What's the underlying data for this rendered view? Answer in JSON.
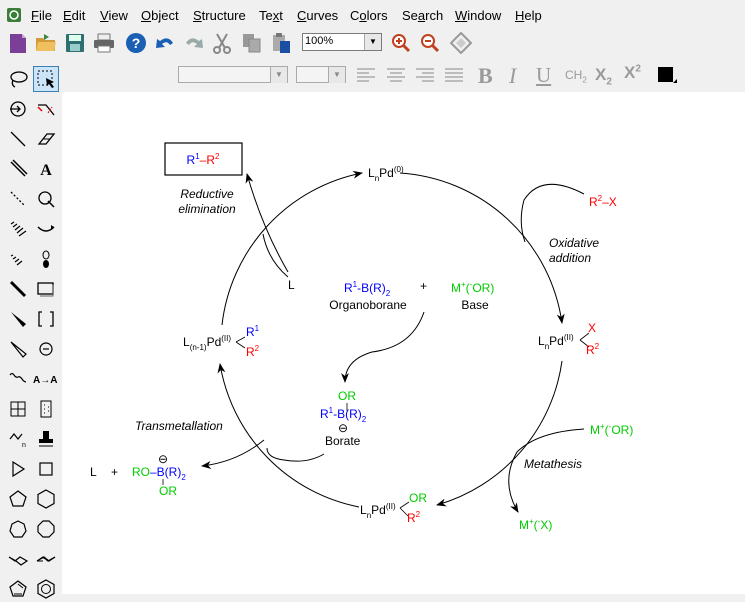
{
  "menu": {
    "items": [
      {
        "label": "File",
        "u": "F",
        "rest": "ile"
      },
      {
        "label": "Edit",
        "u": "E",
        "rest": "dit"
      },
      {
        "label": "View",
        "u": "V",
        "rest": "iew"
      },
      {
        "label": "Object",
        "u": "O",
        "rest": "bject"
      },
      {
        "label": "Structure",
        "u": "S",
        "rest": "tructure"
      },
      {
        "label": "Text",
        "u": "T",
        "rest": "ext"
      },
      {
        "label": "Curves",
        "u": "C",
        "rest": "urves"
      },
      {
        "label": "Colors",
        "u": "o",
        "pre": "C",
        "rest": "lors"
      },
      {
        "label": "Search",
        "u": "",
        "rest": "Search"
      },
      {
        "label": "Window",
        "u": "W",
        "rest": "indow"
      },
      {
        "label": "Help",
        "u": "H",
        "rest": "elp"
      }
    ]
  },
  "toolbar": {
    "zoom_value": "100%"
  },
  "format": {
    "bold": "B",
    "italic": "I",
    "underline": "U",
    "ch2": "CH",
    "ch2_sub": "2",
    "subscript": "X",
    "subscript_sub": "2",
    "superscript": "X",
    "superscript_sup": "2"
  },
  "colors": {
    "blue": "#0000ff",
    "red": "#ff0000",
    "green": "#00cc00",
    "black": "#000000"
  },
  "diagram": {
    "pd0": {
      "base": "L",
      "sub": "n",
      "mid": "Pd",
      "sup": "(0)"
    },
    "product": {
      "r1": "R",
      "sup1": "1",
      "dash": "–R",
      "sup2": "2"
    },
    "reductive": [
      "Reductive",
      "elimination"
    ],
    "r2x": "R",
    "r2x_sup": "2",
    "r2x_rest": "–X",
    "oxidative": [
      "Oxidative",
      "addition"
    ],
    "ligand": "L",
    "organoborane": {
      "r": "R",
      "sup": "1",
      "rest": "-B(R)",
      "sub": "2",
      "label": "Organoborane"
    },
    "plus": "+",
    "base": {
      "m": "M",
      "sup": "+",
      "rest": "(",
      "sup2": "-",
      "rest2": "OR)",
      "label": "Base"
    },
    "pd_left": {
      "base": "L",
      "sub": "(n-1)",
      "mid": "Pd",
      "sup": "(II)",
      "r1": "R",
      "r1sup": "1",
      "r2": "R",
      "r2sup": "2"
    },
    "pd_right": {
      "base": "L",
      "sub": "n",
      "mid": "Pd",
      "sup": "(II)",
      "x": "X",
      "r2": "R",
      "r2sup": "2"
    },
    "borate": {
      "or": "OR",
      "r": "R",
      "sup": "1",
      "b": "-B(R)",
      "sub": "2",
      "minus": "⊖",
      "label": "Borate"
    },
    "transmetallation": "Transmetallation",
    "left_products": {
      "l": "L",
      "plus": "+",
      "ro": "RO",
      "b": "–B(R)",
      "sub": "2",
      "or": "OR",
      "minus": "⊖"
    },
    "mor2": {
      "m": "M",
      "sup": "+",
      "rest": "(",
      "sup2": "-",
      "rest2": "OR)"
    },
    "metathesis": "Metathesis",
    "pd_bottom": {
      "base": "L",
      "sub": "n",
      "mid": "Pd",
      "sup": "(II)",
      "or": "OR",
      "r2": "R",
      "r2sup": "2"
    },
    "mx": {
      "m": "M",
      "sup": "+",
      "rest": "(",
      "sup2": "-",
      "rest2": "X)"
    }
  }
}
